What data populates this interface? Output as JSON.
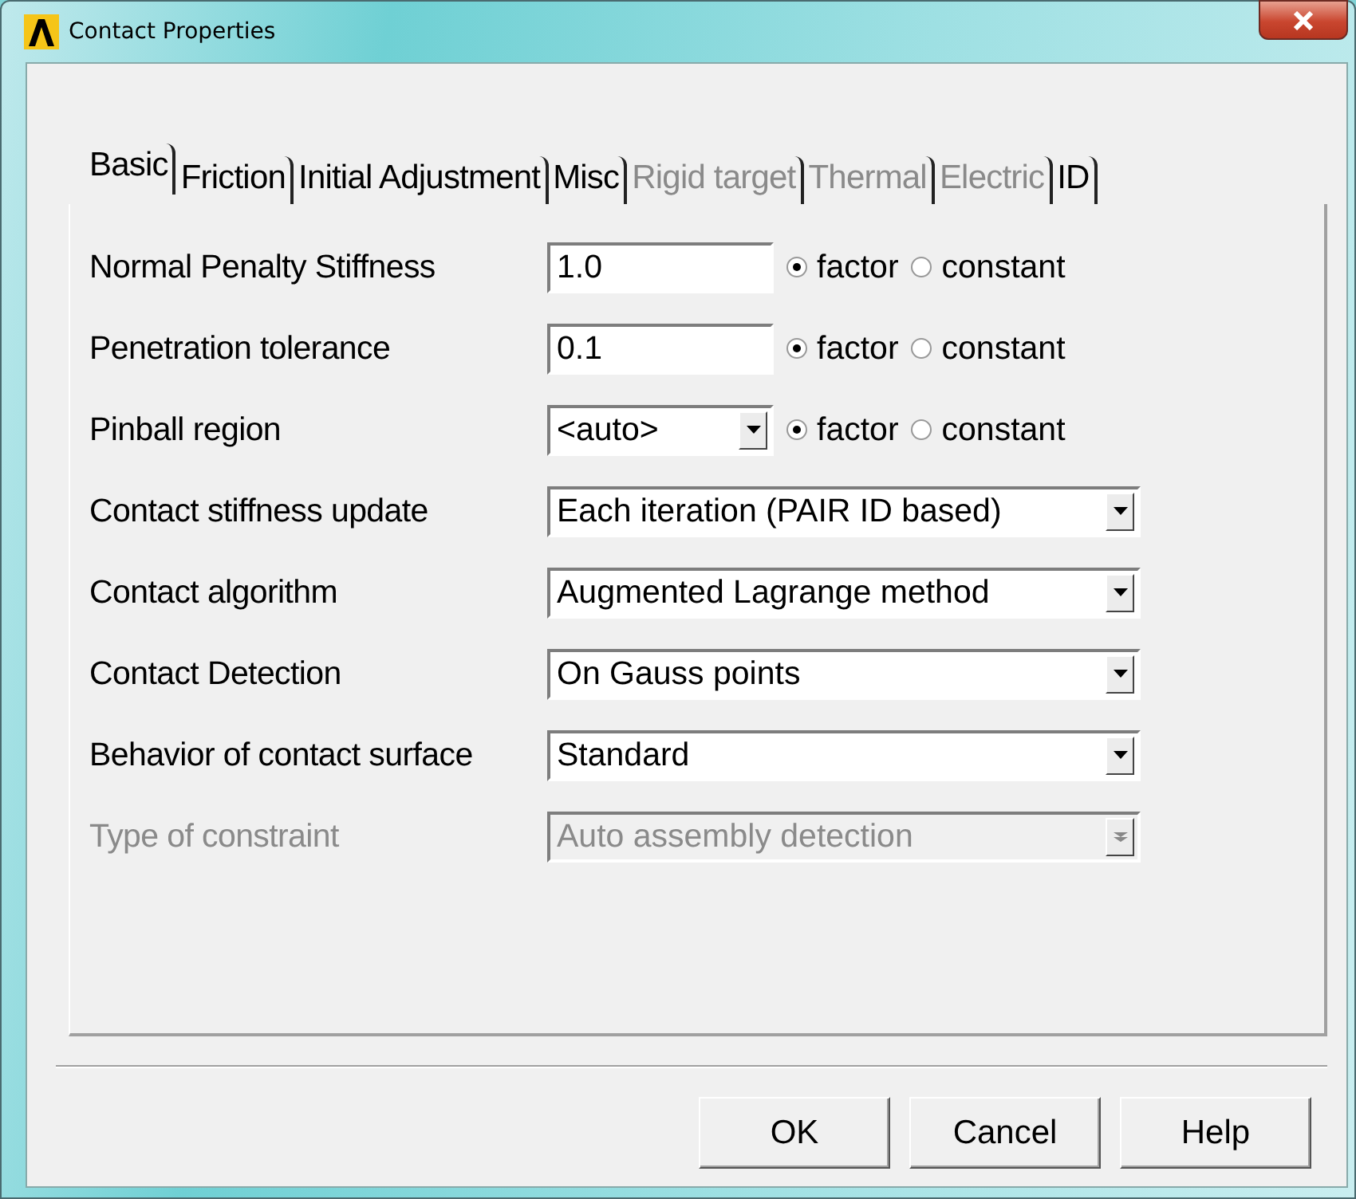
{
  "window": {
    "title": "Contact Properties"
  },
  "tabs": [
    {
      "label": "Basic",
      "selected": true,
      "disabled": false
    },
    {
      "label": "Friction",
      "selected": false,
      "disabled": false
    },
    {
      "label": "Initial Adjustment",
      "selected": false,
      "disabled": false
    },
    {
      "label": "Misc",
      "selected": false,
      "disabled": false
    },
    {
      "label": "Rigid target",
      "selected": false,
      "disabled": true
    },
    {
      "label": "Thermal",
      "selected": false,
      "disabled": true
    },
    {
      "label": "Electric",
      "selected": false,
      "disabled": true
    },
    {
      "label": "ID",
      "selected": false,
      "disabled": false
    }
  ],
  "rows": [
    {
      "kind": "text",
      "label": "Normal Penalty Stiffness",
      "value": "1.0",
      "disabled": false,
      "options": [
        {
          "label": "factor",
          "selected": true
        },
        {
          "label": "constant",
          "selected": false
        }
      ]
    },
    {
      "kind": "text",
      "label": "Penetration tolerance",
      "value": "0.1",
      "disabled": false,
      "options": [
        {
          "label": "factor",
          "selected": true
        },
        {
          "label": "constant",
          "selected": false
        }
      ]
    },
    {
      "kind": "short-combo",
      "label": "Pinball region",
      "value": "<auto>",
      "disabled": false,
      "options": [
        {
          "label": "factor",
          "selected": true
        },
        {
          "label": "constant",
          "selected": false
        }
      ]
    },
    {
      "kind": "combo",
      "label": "Contact stiffness update",
      "value": "Each iteration (PAIR ID based)",
      "disabled": false
    },
    {
      "kind": "combo",
      "label": "Contact algorithm",
      "value": "Augmented Lagrange method",
      "disabled": false
    },
    {
      "kind": "combo",
      "label": "Contact Detection",
      "value": "On Gauss points",
      "disabled": false
    },
    {
      "kind": "combo",
      "label": "Behavior of contact surface",
      "value": "Standard",
      "disabled": false
    },
    {
      "kind": "combo",
      "label": "Type of constraint",
      "value": "Auto assembly detection",
      "disabled": true
    }
  ],
  "buttons": [
    {
      "label": "OK"
    },
    {
      "label": "Cancel"
    },
    {
      "label": "Help"
    }
  ]
}
